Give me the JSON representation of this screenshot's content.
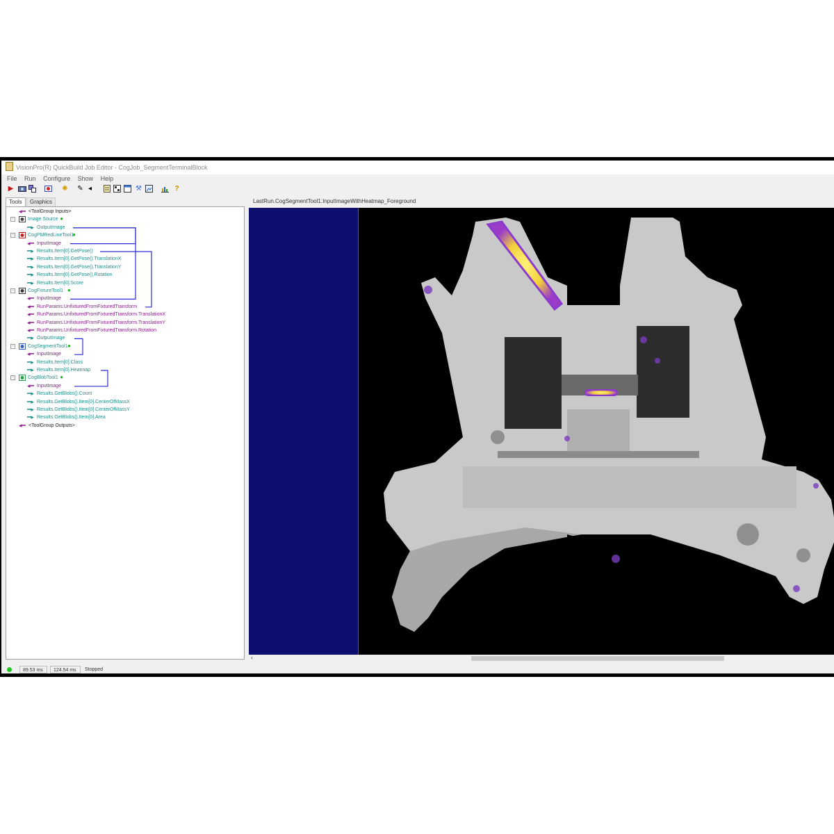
{
  "window": {
    "title": "VisionPro(R) QuickBuild Job Editor - CogJob_SegmentTerminalBlock"
  },
  "menu": [
    "File",
    "Run",
    "Configure",
    "Show",
    "Help"
  ],
  "toolbar": {
    "icons": [
      "run-icon",
      "camera-icon",
      "tools-icon",
      "record-icon",
      "settings-icon",
      "edit-icon",
      "arrow-icon",
      "document-icon",
      "grid-icon",
      "window-icon",
      "build-icon",
      "image-icon",
      "chart-icon",
      "help-icon"
    ]
  },
  "left_tabs": [
    "Tools",
    "Graphics"
  ],
  "tree": [
    {
      "label": "<ToolGroup Inputs>",
      "type": "io-in",
      "level": 1,
      "color": "dark",
      "expand": ""
    },
    {
      "label": "Image Source",
      "type": "tool",
      "level": 1,
      "color": "teal",
      "expand": "-",
      "ok": true,
      "icon": "camera"
    },
    {
      "label": "OutputImage",
      "type": "out",
      "level": 2,
      "color": "teal"
    },
    {
      "label": "CogPMRedLineTool1",
      "type": "tool",
      "level": 1,
      "color": "teal",
      "expand": "-",
      "ok": true,
      "icon": "pm"
    },
    {
      "label": "InputImage",
      "type": "in",
      "level": 2,
      "color": "purple"
    },
    {
      "label": "Results.Item[0].GetPose()",
      "type": "out",
      "level": 2,
      "color": "teal"
    },
    {
      "label": "Results.Item[0].GetPose().TranslationX",
      "type": "out",
      "level": 2,
      "color": "teal"
    },
    {
      "label": "Results.Item[0].GetPose().TranslationY",
      "type": "out",
      "level": 2,
      "color": "teal"
    },
    {
      "label": "Results.Item[0].GetPose().Rotation",
      "type": "out",
      "level": 2,
      "color": "teal"
    },
    {
      "label": "Results.Item[0].Score",
      "type": "out",
      "level": 2,
      "color": "teal"
    },
    {
      "label": "CogFixtureTool1",
      "type": "tool",
      "level": 1,
      "color": "teal",
      "expand": "-",
      "ok": true,
      "icon": "fixture"
    },
    {
      "label": "InputImage",
      "type": "in",
      "level": 2,
      "color": "purple"
    },
    {
      "label": "RunParams.UnfixturedFromFixturedTransform",
      "type": "in",
      "level": 2,
      "color": "purple"
    },
    {
      "label": "RunParams.UnfixturedFromFixturedTransform.TranslationX",
      "type": "in",
      "level": 2,
      "color": "purple"
    },
    {
      "label": "RunParams.UnfixturedFromFixturedTransform.TranslationY",
      "type": "in",
      "level": 2,
      "color": "purple"
    },
    {
      "label": "RunParams.UnfixturedFromFixturedTransform.Rotation",
      "type": "in",
      "level": 2,
      "color": "purple"
    },
    {
      "label": "OutputImage",
      "type": "out",
      "level": 2,
      "color": "teal"
    },
    {
      "label": "CogSegmentTool1",
      "type": "tool",
      "level": 1,
      "color": "teal",
      "expand": "-",
      "ok": true,
      "icon": "segment"
    },
    {
      "label": "InputImage",
      "type": "in",
      "level": 2,
      "color": "purple"
    },
    {
      "label": "Results.Item[0].Class",
      "type": "out",
      "level": 2,
      "color": "teal"
    },
    {
      "label": "Results.Item[0].Heatmap",
      "type": "out",
      "level": 2,
      "color": "teal"
    },
    {
      "label": "CogBlobTool1",
      "type": "tool",
      "level": 1,
      "color": "teal",
      "expand": "-",
      "ok": true,
      "icon": "blob"
    },
    {
      "label": "InputImage",
      "type": "in",
      "level": 2,
      "color": "purple"
    },
    {
      "label": "Results.GetBlobs().Count",
      "type": "out",
      "level": 2,
      "color": "teal"
    },
    {
      "label": "Results.GetBlobs().Item[0].CenterOfMassX",
      "type": "out",
      "level": 2,
      "color": "teal"
    },
    {
      "label": "Results.GetBlobs().Item[0].CenterOfMassY",
      "type": "out",
      "level": 2,
      "color": "teal"
    },
    {
      "label": "Results.GetBlobs().Item[0].Area",
      "type": "out",
      "level": 2,
      "color": "teal"
    },
    {
      "label": "<ToolGroup Outputs>",
      "type": "io-out",
      "level": 1,
      "color": "dark",
      "expand": ""
    }
  ],
  "image_panel": {
    "title": "LastRun.CogSegmentTool1.InputImageWithHeatmap_Foreground"
  },
  "status": {
    "time1": "89.53 ms",
    "time2": "124.54 ms",
    "state": "Stopped",
    "indicator_color": "#1fc51f"
  },
  "colors": {
    "input_link": "#8b1f8b",
    "output_link": "#1f8f8a",
    "connector": "#2b2bd6",
    "display_background": "#0d0f6e"
  }
}
